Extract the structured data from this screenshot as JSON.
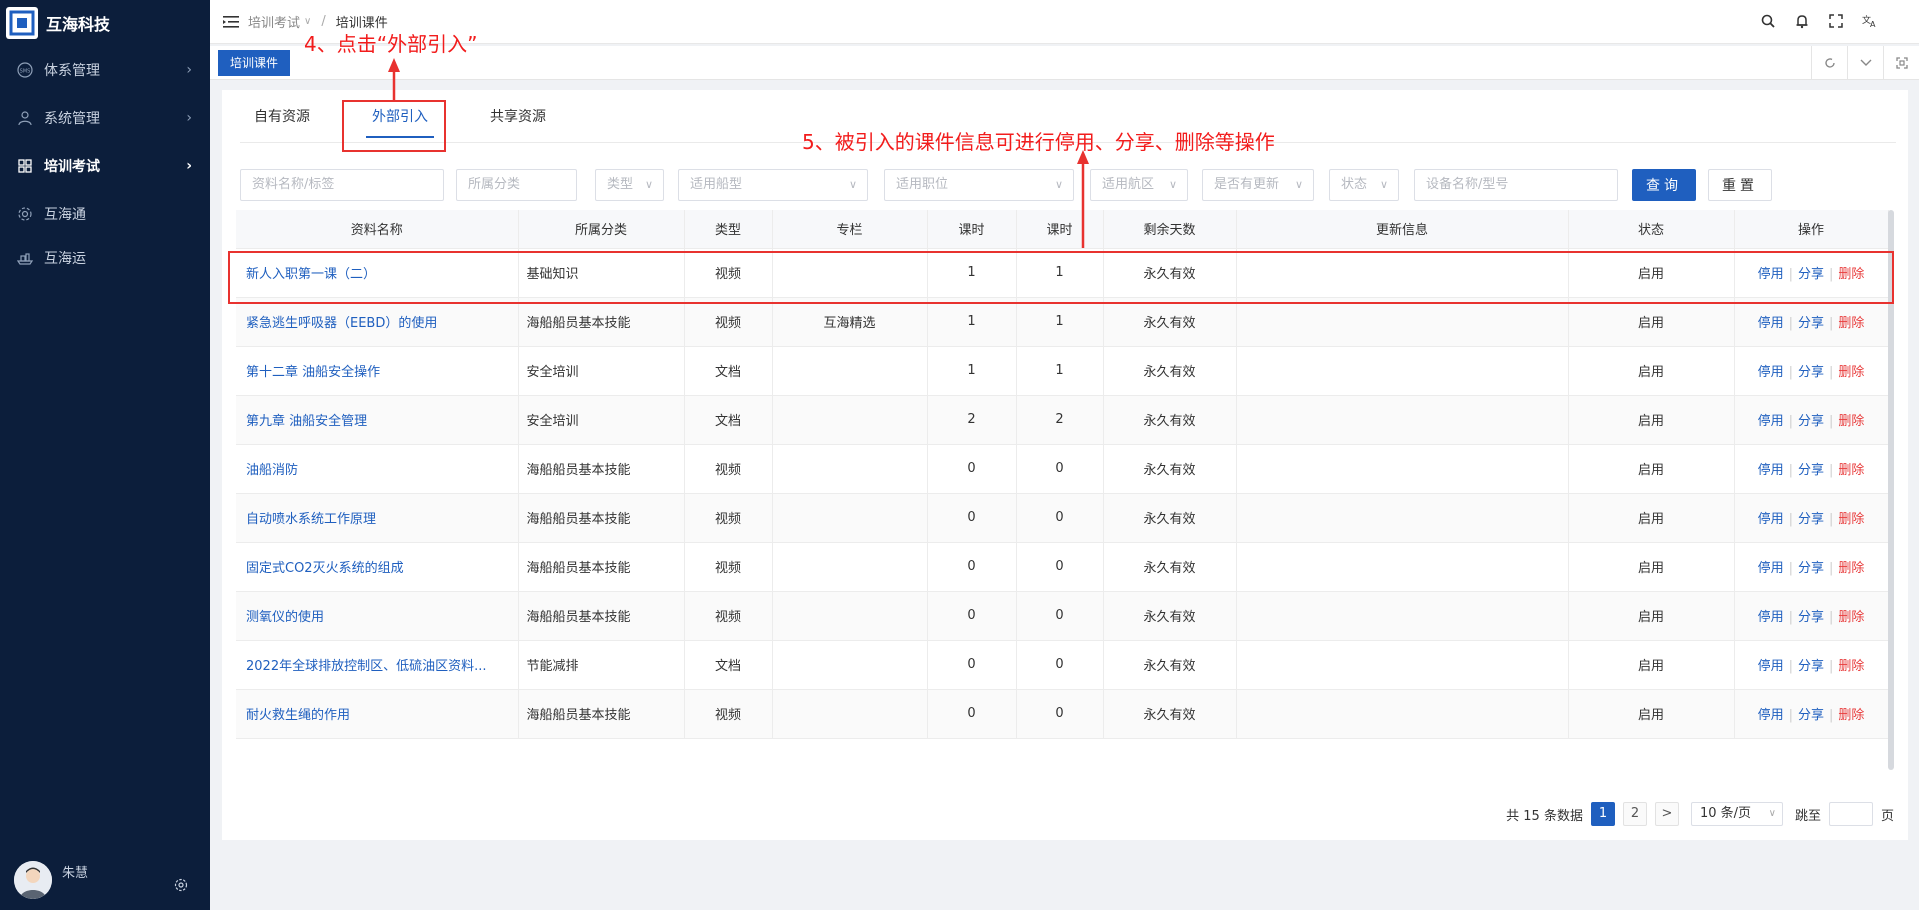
{
  "app": {
    "logo_text": "互海科技"
  },
  "sidebar": {
    "items": [
      {
        "label": "体系管理",
        "icon": "sms-icon",
        "active": false
      },
      {
        "label": "系统管理",
        "icon": "user-icon",
        "active": false
      },
      {
        "label": "培训考试",
        "icon": "grid-icon",
        "active": true
      },
      {
        "label": "互海通",
        "icon": "gear-icon",
        "active": false
      },
      {
        "label": "互海运",
        "icon": "ship-icon",
        "active": false
      }
    ],
    "user_name": "朱慧"
  },
  "header": {
    "breadcrumb_parent": "培训考试",
    "breadcrumb_sep": "/",
    "breadcrumb_current": "培训课件"
  },
  "page_tab": {
    "label": "培训课件"
  },
  "resource_tabs": [
    {
      "label": "自有资源",
      "active": false
    },
    {
      "label": "外部引入",
      "active": true
    },
    {
      "label": "共享资源",
      "active": false
    }
  ],
  "filters": {
    "name_placeholder": "资料名称/标签",
    "category_placeholder": "所属分类",
    "type_placeholder": "类型",
    "vessel_type_placeholder": "适用船型",
    "position_placeholder": "适用职位",
    "area_placeholder": "适用航区",
    "updated_placeholder": "是否有更新",
    "status_placeholder": "状态",
    "device_placeholder": "设备名称/型号",
    "query_label": "查询",
    "reset_label": "重置"
  },
  "table": {
    "columns": [
      "资料名称",
      "所属分类",
      "类型",
      "专栏",
      "课时",
      "课时",
      "剩余天数",
      "更新信息",
      "状态",
      "操作"
    ],
    "rows": [
      {
        "name": "新人入职第一课（二）",
        "category": "基础知识",
        "type": "视频",
        "column": "",
        "hours1": "1",
        "hours2": "1",
        "remaining": "永久有效",
        "update": "",
        "status": "启用"
      },
      {
        "name": "紧急逃生呼吸器（EEBD）的使用",
        "category": "海船船员基本技能",
        "type": "视频",
        "column": "互海精选",
        "hours1": "1",
        "hours2": "1",
        "remaining": "永久有效",
        "update": "",
        "status": "启用"
      },
      {
        "name": "第十二章 油船安全操作",
        "category": "安全培训",
        "type": "文档",
        "column": "",
        "hours1": "1",
        "hours2": "1",
        "remaining": "永久有效",
        "update": "",
        "status": "启用"
      },
      {
        "name": "第九章 油船安全管理",
        "category": "安全培训",
        "type": "文档",
        "column": "",
        "hours1": "2",
        "hours2": "2",
        "remaining": "永久有效",
        "update": "",
        "status": "启用"
      },
      {
        "name": "油船消防",
        "category": "海船船员基本技能",
        "type": "视频",
        "column": "",
        "hours1": "0",
        "hours2": "0",
        "remaining": "永久有效",
        "update": "",
        "status": "启用"
      },
      {
        "name": "自动喷水系统工作原理",
        "category": "海船船员基本技能",
        "type": "视频",
        "column": "",
        "hours1": "0",
        "hours2": "0",
        "remaining": "永久有效",
        "update": "",
        "status": "启用"
      },
      {
        "name": "固定式CO2灭火系统的组成",
        "category": "海船船员基本技能",
        "type": "视频",
        "column": "",
        "hours1": "0",
        "hours2": "0",
        "remaining": "永久有效",
        "update": "",
        "status": "启用"
      },
      {
        "name": "测氧仪的使用",
        "category": "海船船员基本技能",
        "type": "视频",
        "column": "",
        "hours1": "0",
        "hours2": "0",
        "remaining": "永久有效",
        "update": "",
        "status": "启用"
      },
      {
        "name": "2022年全球排放控制区、低硫油区资料...",
        "category": "节能减排",
        "type": "文档",
        "column": "",
        "hours1": "0",
        "hours2": "0",
        "remaining": "永久有效",
        "update": "",
        "status": "启用"
      },
      {
        "name": "耐火救生绳的作用",
        "category": "海船船员基本技能",
        "type": "视频",
        "column": "",
        "hours1": "0",
        "hours2": "0",
        "remaining": "永久有效",
        "update": "",
        "status": "启用"
      }
    ],
    "op_disable": "停用",
    "op_share": "分享",
    "op_delete": "删除"
  },
  "pagination": {
    "total_text": "共 15 条数据",
    "pages": [
      "1",
      "2"
    ],
    "current": "1",
    "next": ">",
    "page_size": "10 条/页",
    "jump_label": "跳至",
    "page_suffix": "页"
  },
  "annotations": {
    "step4": "4、点击“外部引入”",
    "step5": "5、被引入的课件信息可进行停用、分享、删除等操作"
  },
  "colors": {
    "sidebar_bg": "#0c1e3b",
    "primary": "#1f5fbf",
    "status_green": "#1fad36",
    "delete_red": "#e83b3b",
    "annotation_red": "#f21c1c"
  }
}
